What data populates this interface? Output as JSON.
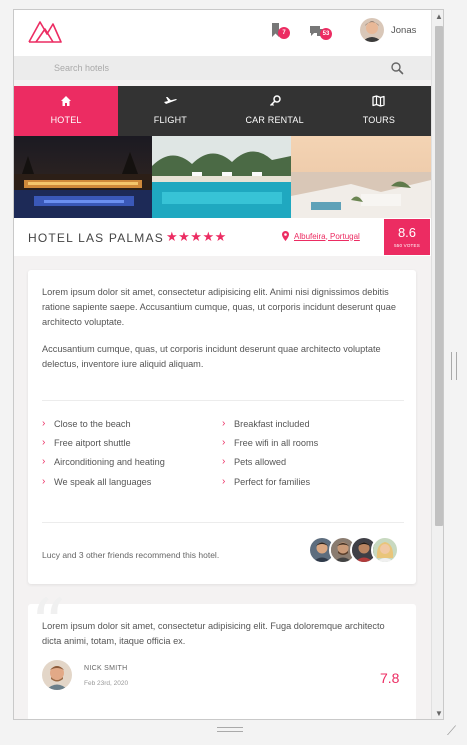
{
  "header": {
    "user_name": "Jonas",
    "notifications_count": "7",
    "messages_count": "53"
  },
  "search": {
    "placeholder": "Search hotels"
  },
  "tabs": [
    {
      "label": "HOTEL",
      "icon": "home-icon",
      "active": true
    },
    {
      "label": "FLIGHT",
      "icon": "plane-icon",
      "active": false
    },
    {
      "label": "CAR RENTAL",
      "icon": "key-icon",
      "active": false
    },
    {
      "label": "TOURS",
      "icon": "map-icon",
      "active": false
    }
  ],
  "hotel": {
    "name": "HOTEL LAS PALMAS",
    "stars": "★★★★★",
    "location": "Albufeira, Portugal",
    "score": "8.6",
    "votes": "550 VOTES"
  },
  "description": {
    "paragraph1": "Lorem ipsum dolor sit amet, consectetur adipisicing elit. Animi nisi dignissimos debitis ratione sapiente saepe. Accusantium cumque, quas, ut corporis incidunt deserunt quae architecto voluptate.",
    "paragraph2": "Accusantium cumque, quas, ut corporis incidunt deserunt quae architecto voluptate delectus, inventore iure aliquid aliquam."
  },
  "features": [
    "Close to the beach",
    "Breakfast included",
    "Free aitport shuttle",
    "Free wifi in all rooms",
    "Airconditioning and heating",
    "Pets allowed",
    "We speak all languages",
    "Perfect for families"
  ],
  "friends": {
    "text": "Lucy and 3 other friends recommend this hotel."
  },
  "review": {
    "text": "Lorem ipsum dolor sit amet, consectetur adipisicing elit. Fuga doloremque architecto dicta animi, totam, itaque officia ex.",
    "author": "NICK SMITH",
    "date": "Feb 23rd, 2020",
    "score": "7.8"
  },
  "colors": {
    "accent": "#ec2c62",
    "dark": "#333333"
  }
}
